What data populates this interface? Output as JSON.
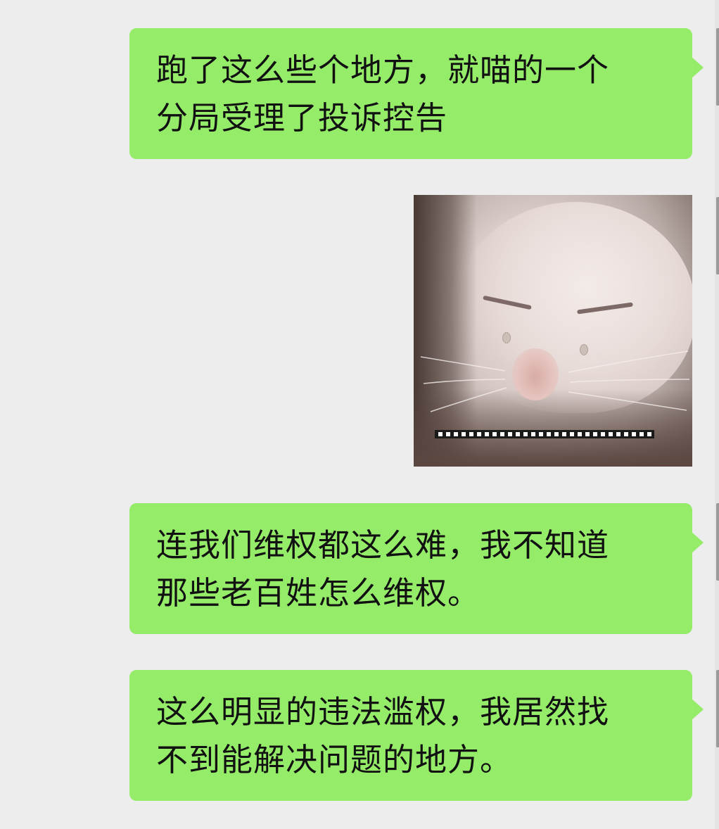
{
  "conversation": {
    "messages": [
      {
        "type": "text",
        "sender": "self",
        "lines": [
          "跑了这么些个地方，就喵的一个",
          "分局受理了投诉控告"
        ]
      },
      {
        "type": "sticker",
        "sender": "self",
        "description": "crying-cat-sticker",
        "caption": "……………………"
      },
      {
        "type": "text",
        "sender": "self",
        "lines": [
          "连我们维权都这么难，我不知道",
          "那些老百姓怎么维权。"
        ]
      },
      {
        "type": "text",
        "sender": "self",
        "lines": [
          "这么明显的违法滥权，我居然找",
          "不到能解决问题的地方。"
        ]
      }
    ]
  },
  "colors": {
    "background": "#ededed",
    "self_bubble": "#95ec69",
    "text": "#111111"
  }
}
